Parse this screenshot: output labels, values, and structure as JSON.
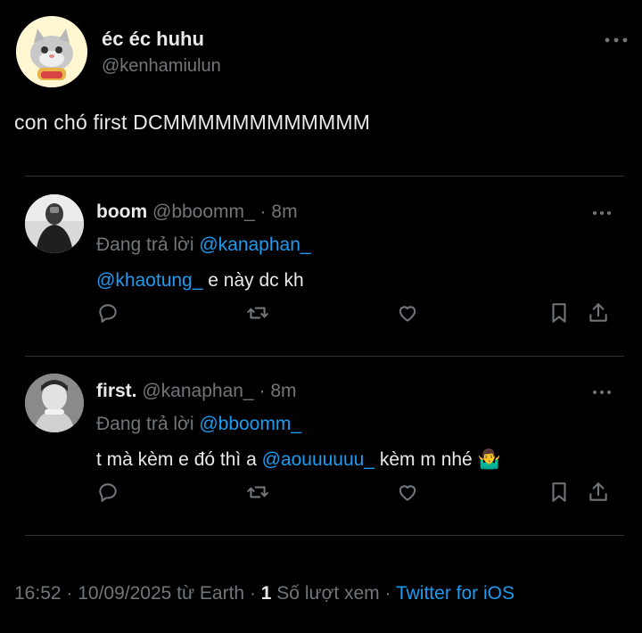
{
  "author": {
    "display_name": "éc éc huhu",
    "handle": "@kenhamiulun"
  },
  "tweet": {
    "text": "con chó first DCMMMMMMMMMMMM",
    "more_icon": "more-horizontal-icon"
  },
  "replies": [
    {
      "name": "boom",
      "handle": "@bboomm_",
      "sep": "·",
      "time": "8m",
      "replying_prefix": "Đang trả lời ",
      "replying_to": "@kanaphan_",
      "body_mention": "@khaotung_",
      "body_text": " e này dc kh",
      "body_lead": "",
      "body_tail": ""
    },
    {
      "name": "first.",
      "handle": "@kanaphan_",
      "sep": "·",
      "time": "8m",
      "replying_prefix": "Đang trả lời ",
      "replying_to": "@bboomm_",
      "body_lead": "t mà kèm e đó thì a ",
      "body_mention": "@aouuuuuu_",
      "body_tail": " kèm m nhé ",
      "body_emoji": "🤷‍♂️"
    }
  ],
  "action_icons": [
    "reply-icon",
    "retweet-icon",
    "like-icon",
    "bookmark-icon",
    "share-icon"
  ],
  "footer": {
    "time": "16:52",
    "sep1": " · ",
    "date": "10/09/2025",
    "from": " từ Earth",
    "sep2": " · ",
    "views_count": "1",
    "views_label": " Số lượt xem",
    "sep3": " · ",
    "client": "Twitter for iOS"
  },
  "colors": {
    "background": "#000000",
    "text": "#e7e9ea",
    "muted": "#71767b",
    "link": "#1d9bf0",
    "divider": "#2f3336"
  }
}
